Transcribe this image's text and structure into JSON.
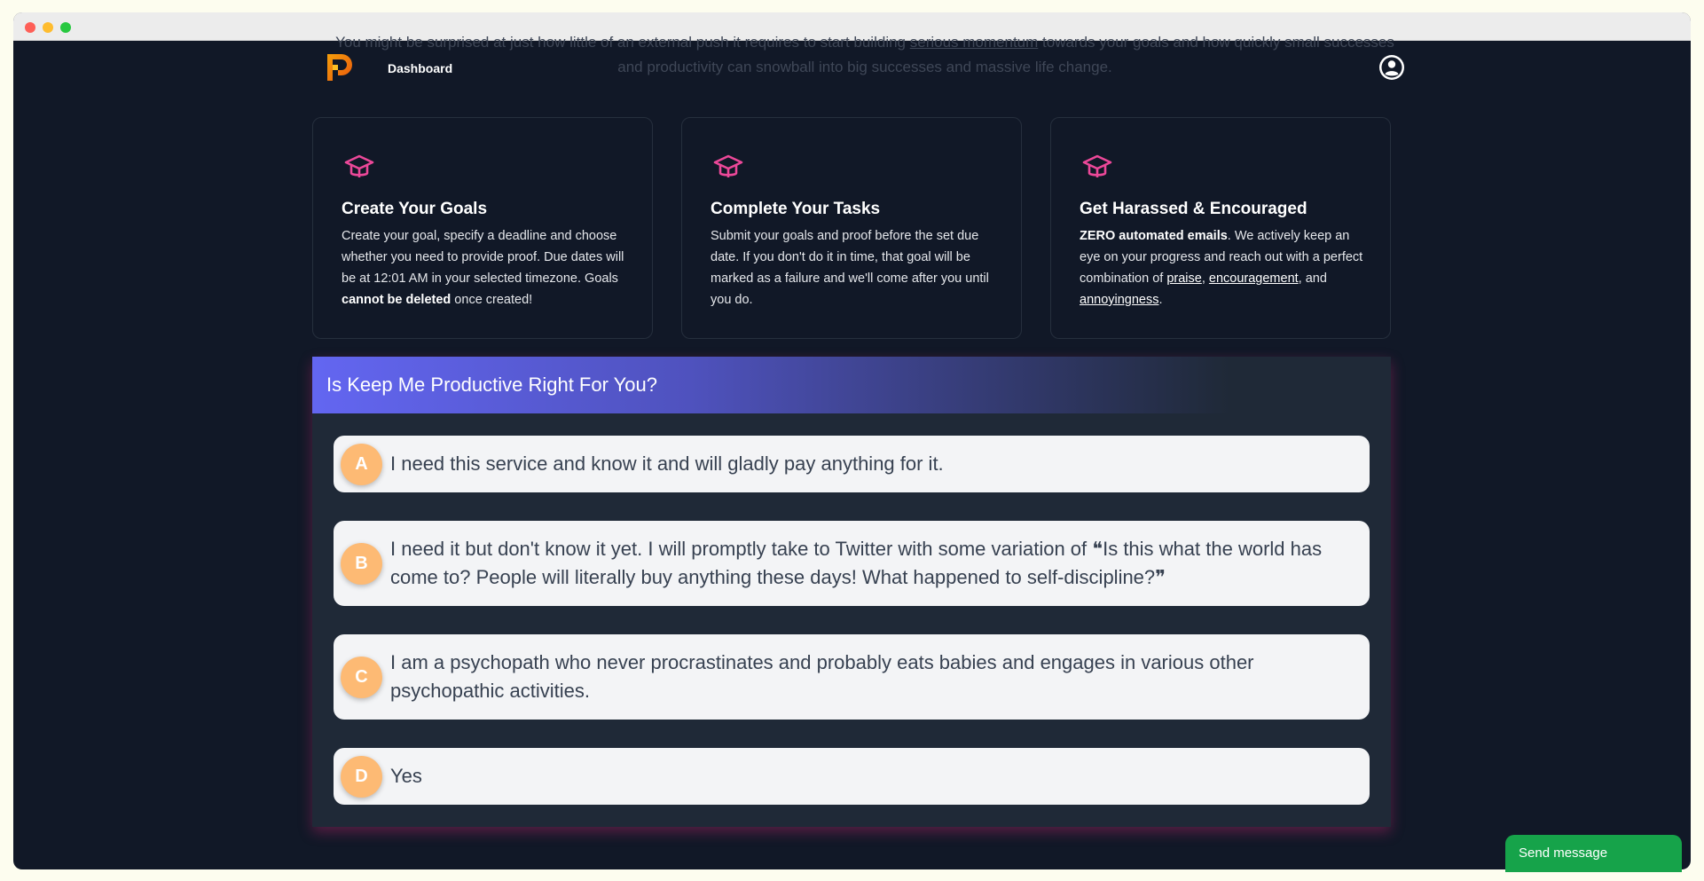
{
  "hero": {
    "line1_start": "You might be surprised at just how little of an external push it requires to start building ",
    "line1_link": "serious momentum",
    "line1_end": " towards your goals and how quickly small successes",
    "line2": "and productivity can snowball into big successes and massive life change."
  },
  "nav": {
    "dashboard_label": "Dashboard"
  },
  "cards": [
    {
      "title": "Create Your Goals",
      "text_1": "Create your goal, specify a deadline and choose whether you need to provide proof. Due dates will be at 12:01 AM in your selected timezone. Goals ",
      "text_bold": "cannot be deleted",
      "text_2": " once created!"
    },
    {
      "title": "Complete Your Tasks",
      "text_1": "Submit your goals and proof before the set due date. If you don't do it in time, that goal will be marked as a failure and we'll come after you until you do."
    },
    {
      "title": "Get Harassed & Encouraged",
      "text_bold": "ZERO automated emails",
      "text_1": ". We actively keep an eye on your progress and reach out with a perfect combination of ",
      "link_1": "praise",
      "sep_1": ", ",
      "link_2": "encouragement",
      "sep_2": ", and ",
      "link_3": "annoyingness",
      "end": "."
    }
  ],
  "quiz": {
    "title": "Is Keep Me Productive Right For You?",
    "options": [
      {
        "letter": "A",
        "text": "I need this service and know it and will gladly pay anything for it."
      },
      {
        "letter": "B",
        "text": "I need it but don't know it yet. I will promptly take to Twitter with some variation of ❝Is this what the world has come to? People will literally buy anything these days! What happened to self-discipline?❞"
      },
      {
        "letter": "C",
        "text": "I am a psychopath who never procrastinates and probably eats babies and engages in various other psychopathic activities."
      },
      {
        "letter": "D",
        "text": "Yes"
      }
    ]
  },
  "chat": {
    "send_label": "Send message"
  },
  "colors": {
    "page_bg": "#111827",
    "accent_pink": "#ec4899",
    "letter_badge": "#fdba74",
    "send_green": "#16a34a"
  },
  "icons": {
    "logo": "brand-logo",
    "profile": "user-circle-icon",
    "card": "graduation-cap-icon"
  }
}
